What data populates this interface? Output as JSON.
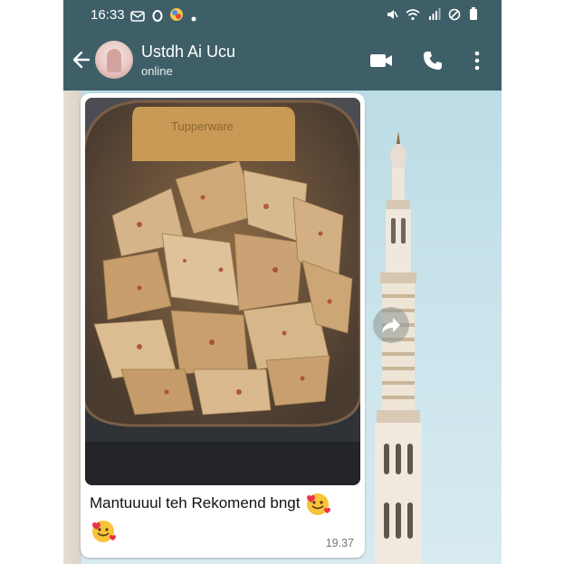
{
  "status_bar": {
    "time": "16:33",
    "left_icons": [
      "mail-icon",
      "circle-icon",
      "app-icon",
      "dot-icon"
    ],
    "right_icons": [
      "mute-icon",
      "wifi-icon",
      "signal-icon",
      "dnd-icon",
      "battery-icon"
    ]
  },
  "header": {
    "contact_name": "Ustdh Ai Ucu",
    "contact_status": "online",
    "color": "#3f5f68"
  },
  "message": {
    "caption": "Mantuuuul teh Rekomend bngt",
    "emoji_1": "smiling-face-with-hearts-emoji",
    "emoji_2": "smiling-face-with-hearts-emoji",
    "time": "19.37",
    "image_lid_text": "Tupperware"
  }
}
